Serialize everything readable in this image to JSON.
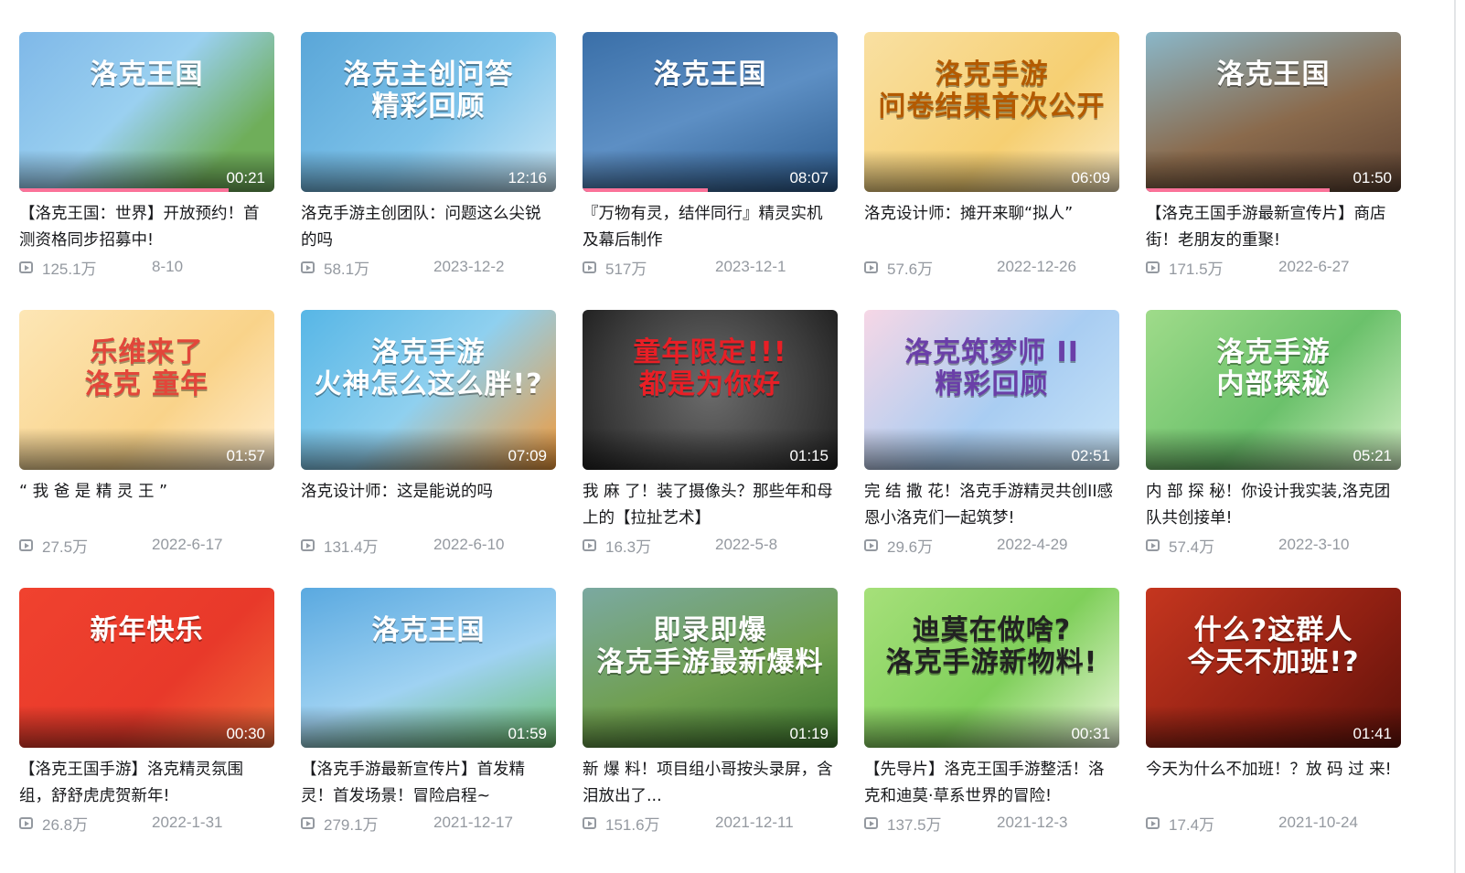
{
  "videos": [
    {
      "title": "【洛克王国：世界】开放预约！首测资格同步招募中!",
      "plays": "125.1万",
      "date": "8-10",
      "duration": "00:21",
      "thumb_text": "洛克王国",
      "bg": "linear-gradient(135deg,#7fb8e8,#9ad0f0 45%,#6fae5a 80%)",
      "accent": "#ffffff",
      "progress": 0.82
    },
    {
      "title": "洛克手游主创团队：问题这么尖锐的吗",
      "plays": "58.1万",
      "date": "2023-12-2",
      "duration": "12:16",
      "thumb_text": "洛克主创问答\n精彩回顾",
      "bg": "linear-gradient(135deg,#5aa6d8,#7ec3ea 55%,#c8e6f6)",
      "accent": "#ffffff",
      "progress": 0.0
    },
    {
      "title": "『万物有灵，结伴同行』精灵实机及幕后制作",
      "plays": "517万",
      "date": "2023-12-1",
      "duration": "08:07",
      "thumb_text": "洛克王国",
      "bg": "linear-gradient(160deg,#3a6fa8,#5d8fc4 50%,#2c5a8c)",
      "accent": "#ffffff",
      "progress": 0.49
    },
    {
      "title": "洛克设计师：摊开来聊“拟人”",
      "plays": "57.6万",
      "date": "2022-12-26",
      "duration": "06:09",
      "thumb_text": "洛克手游\n问卷结果首次公开",
      "bg": "linear-gradient(135deg,#f9e0a2,#f6cf72 60%,#fbe9bf)",
      "accent": "#b35a00",
      "progress": 0.0
    },
    {
      "title": "【洛克王国手游最新宣传片】商店街！老朋友的重聚!",
      "plays": "171.5万",
      "date": "2022-6-27",
      "duration": "01:50",
      "thumb_text": "洛克王国",
      "bg": "linear-gradient(160deg,#8ab7c9,#8a6a4c 55%,#5d4232)",
      "accent": "#ffffff",
      "progress": 0.72
    },
    {
      "title": "“ 我 爸 是 精 灵 王 ”",
      "plays": "27.5万",
      "date": "2022-6-17",
      "duration": "01:57",
      "thumb_text": "乐维来了\n洛克 童年",
      "bg": "linear-gradient(135deg,#fde6b5,#f9d38a 60%,#ffeccc)",
      "accent": "#e2463a",
      "progress": 0.0
    },
    {
      "title": "洛克设计师：这是能说的吗",
      "plays": "131.4万",
      "date": "2022-6-10",
      "duration": "07:09",
      "thumb_text": "洛克手游\n火神怎么这么胖!?",
      "bg": "linear-gradient(135deg,#57b6e6,#8fd0ef 50%,#f29a3a)",
      "accent": "#ffffff",
      "progress": 0.0
    },
    {
      "title": "我 麻 了！装了摄像头？那些年和母上的【拉扯艺术】",
      "plays": "16.3万",
      "date": "2022-5-8",
      "duration": "01:15",
      "thumb_text": "童年限定!!!\n都是为你好",
      "bg": "radial-gradient(circle at 50% 50%,#6b6b6b,#3a3a3a 70%,#222)",
      "accent": "#e81f26",
      "progress": 0.0
    },
    {
      "title": "完 结 撒 花！洛克手游精灵共创II感恩小洛克们一起筑梦!",
      "plays": "29.6万",
      "date": "2022-4-29",
      "duration": "02:51",
      "thumb_text": "洛克筑梦师 II\n精彩回顾",
      "bg": "linear-gradient(135deg,#f6d7e6,#a9cdf2 55%,#c7e4f8)",
      "accent": "#6a3fa8",
      "progress": 0.0
    },
    {
      "title": "内 部 探 秘！你设计我实装,洛克团队共创接单!",
      "plays": "57.4万",
      "date": "2022-3-10",
      "duration": "05:21",
      "thumb_text": "洛克手游\n内部探秘",
      "bg": "linear-gradient(135deg,#9fdb8a,#6bc16b 55%,#cfeec1)",
      "accent": "#ffffff",
      "progress": 0.0
    },
    {
      "title": "【洛克王国手游】洛克精灵氛围组，舒舒虎虎贺新年!",
      "plays": "26.8万",
      "date": "2022-1-31",
      "duration": "00:30",
      "thumb_text": "新年快乐",
      "bg": "linear-gradient(135deg,#f0422f,#e8392a 60%,#f26a3a)",
      "accent": "#ffffff",
      "progress": 0.0
    },
    {
      "title": "【洛克手游最新宣传片】首发精灵！首发场景！冒险启程~",
      "plays": "279.1万",
      "date": "2021-12-17",
      "duration": "01:59",
      "thumb_text": "洛克王国",
      "bg": "linear-gradient(160deg,#5aa9e0,#9fd2f2 55%,#6cbf6c)",
      "accent": "#ffffff",
      "progress": 0.0
    },
    {
      "title": "新 爆 料！项目组小哥按头录屏，含泪放出了...",
      "plays": "151.6万",
      "date": "2021-12-11",
      "duration": "01:19",
      "thumb_text": "即录即爆\n洛克手游最新爆料",
      "bg": "linear-gradient(160deg,#7ba9a1,#6f9f4f 55%,#3f7a2f)",
      "accent": "#ffffff",
      "progress": 0.0
    },
    {
      "title": "【先导片】洛克王国手游整活！洛克和迪莫·草系世界的冒险!",
      "plays": "137.5万",
      "date": "2021-12-3",
      "duration": "00:31",
      "thumb_text": "迪莫在做啥?\n洛克手游新物料!",
      "bg": "linear-gradient(135deg,#a6e07a,#7fcf5a 55%,#e9f7d8)",
      "accent": "#222222",
      "progress": 0.0
    },
    {
      "title": "今天为什么不加班！？放 码 过 来!",
      "plays": "17.4万",
      "date": "2021-10-24",
      "duration": "01:41",
      "thumb_text": "什么?这群人\n今天不加班!?",
      "bg": "linear-gradient(135deg,#c5361f,#8e1f12 60%,#5e120a)",
      "accent": "#ffffff",
      "progress": 0.0
    }
  ]
}
